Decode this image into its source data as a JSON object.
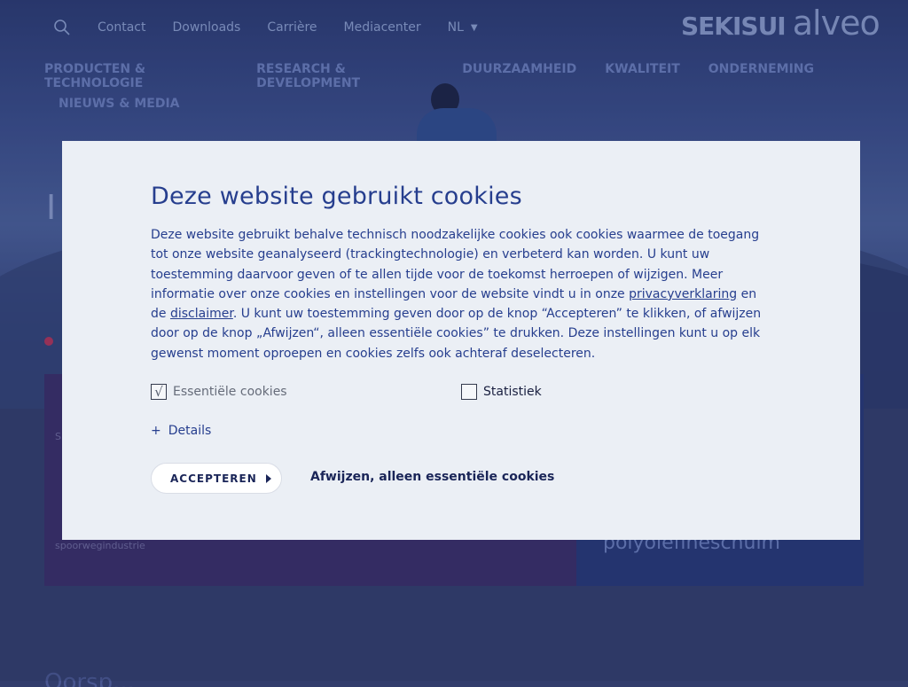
{
  "background": {
    "topnav": {
      "search_icon": "search-icon",
      "links": [
        "Contact",
        "Downloads",
        "Carrière",
        "Mediacenter"
      ],
      "language": "NL"
    },
    "logo": {
      "brand1": "SEKISUI",
      "brand2": "alveo"
    },
    "mainnav": {
      "row1": [
        "PRODUCTEN & TECHNOLOGIE",
        "RESEARCH & DEVELOPMENT",
        "DUURZAAMHEID",
        "KWALITEIT",
        "ONDERNEMING"
      ],
      "row2": [
        "NIEUWS & MEDIA"
      ]
    },
    "hero_title": "I",
    "card_left": {
      "tag": "Spo",
      "tag2": "spoorwegindustrie"
    },
    "card_right": {
      "text": "polyolefineschuim"
    },
    "bottom_title": "Oorsp..."
  },
  "cookie_modal": {
    "title": "Deze website gebruikt cookies",
    "text_part1": "Deze website gebruikt behalve technisch noodzakelijke cookies ook cookies waarmee de toegang tot onze website geanalyseerd (trackingtechnologie) en verbeterd kan worden. U kunt uw toestemming daarvoor geven of te allen tijde voor de toekomst herroepen of wijzigen. Meer informatie over onze cookies en instellingen voor de website vindt u in onze ",
    "privacy_link": "privacyverklaring",
    "text_part2": " en de ",
    "disclaimer_link": "disclaimer",
    "text_part3": ". U kunt uw toestemming geven door op de knop “Accepteren” te klikken, of afwijzen door op de knop „Afwijzen“, alleen essentiële cookies” te drukken. Deze instellingen kunt u op elk gewenst moment oproepen en cookies zelfs ook achteraf deselecteren.",
    "checkbox_essential": {
      "label": "Essentiële cookies",
      "checked": true,
      "mark": "√"
    },
    "checkbox_statistics": {
      "label": "Statistiek",
      "checked": false
    },
    "details": {
      "plus": "+",
      "label": "Details"
    },
    "accept_button": "ACCEPTEREN",
    "reject_button": "Afwijzen, alleen essentiële cookies"
  }
}
